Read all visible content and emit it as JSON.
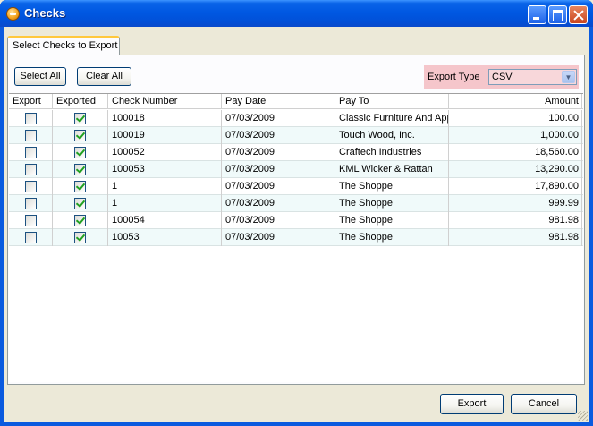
{
  "window": {
    "title": "Checks",
    "accent": "#0054E3"
  },
  "tab": {
    "label": "Select Checks to Export"
  },
  "toolbar": {
    "select_all_label": "Select All",
    "clear_all_label": "Clear All",
    "export_type_label": "Export Type",
    "export_type_value": "CSV",
    "export_type_highlight": "#F5C6CB"
  },
  "grid": {
    "columns": [
      "Export",
      "Exported",
      "Check Number",
      "Pay Date",
      "Pay To",
      "Amount"
    ],
    "rows": [
      {
        "export": false,
        "exported": true,
        "check_number": "100018",
        "pay_date": "07/03/2009",
        "pay_to": "Classic Furniture And App",
        "amount": "100.00"
      },
      {
        "export": false,
        "exported": true,
        "check_number": "100019",
        "pay_date": "07/03/2009",
        "pay_to": "Touch Wood, Inc.",
        "amount": "1,000.00"
      },
      {
        "export": false,
        "exported": true,
        "check_number": "100052",
        "pay_date": "07/03/2009",
        "pay_to": "Craftech Industries",
        "amount": "18,560.00"
      },
      {
        "export": false,
        "exported": true,
        "check_number": "100053",
        "pay_date": "07/03/2009",
        "pay_to": "KML Wicker & Rattan",
        "amount": "13,290.00"
      },
      {
        "export": false,
        "exported": true,
        "check_number": "1",
        "pay_date": "07/03/2009",
        "pay_to": "The Shoppe",
        "amount": "17,890.00"
      },
      {
        "export": false,
        "exported": true,
        "check_number": "1",
        "pay_date": "07/03/2009",
        "pay_to": "The Shoppe",
        "amount": "999.99"
      },
      {
        "export": false,
        "exported": true,
        "check_number": "100054",
        "pay_date": "07/03/2009",
        "pay_to": "The Shoppe",
        "amount": "981.98"
      },
      {
        "export": false,
        "exported": true,
        "check_number": "10053",
        "pay_date": "07/03/2009",
        "pay_to": "The Shoppe",
        "amount": "981.98"
      }
    ]
  },
  "footer": {
    "export_label": "Export",
    "cancel_label": "Cancel"
  }
}
